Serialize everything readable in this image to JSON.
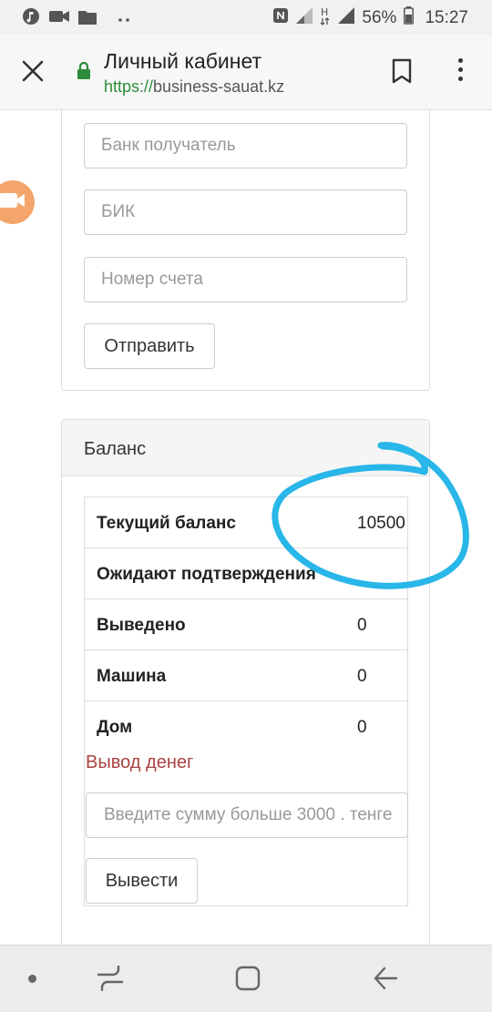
{
  "status_bar": {
    "battery": "56%",
    "time": "15:27",
    "left_icons": [
      "music-icon",
      "video-icon",
      "folder-icon",
      "more-dots-icon"
    ],
    "right_icons": [
      "nfc-icon",
      "signal-icon",
      "h-network-icon",
      "signal-icon",
      "battery-icon"
    ]
  },
  "toolbar": {
    "title": "Личный кабинет",
    "url_scheme": "https://",
    "url_host": "business-sauat.kz"
  },
  "bank_form": {
    "bank_placeholder": "Банк получатель",
    "bik_placeholder": "БИК",
    "account_placeholder": "Номер счета",
    "submit_label": "Отправить"
  },
  "balance": {
    "header": "Баланс",
    "rows": [
      {
        "label": "Текущий баланс",
        "value": "10500"
      },
      {
        "label": "Ожидают подтверждения",
        "value": ""
      },
      {
        "label": "Выведено",
        "value": "0"
      },
      {
        "label": "Машина",
        "value": "0"
      },
      {
        "label": "Дом",
        "value": "0"
      }
    ],
    "withdraw_title": "Вывод денег",
    "amount_placeholder": "Введите сумму больше 3000 . тенге",
    "withdraw_button": "Вывести"
  },
  "colors": {
    "annotation": "#29b6e8",
    "accent_green": "#2e8b3a",
    "withdraw_red": "#a94442",
    "float_video": "#f4a56b"
  }
}
